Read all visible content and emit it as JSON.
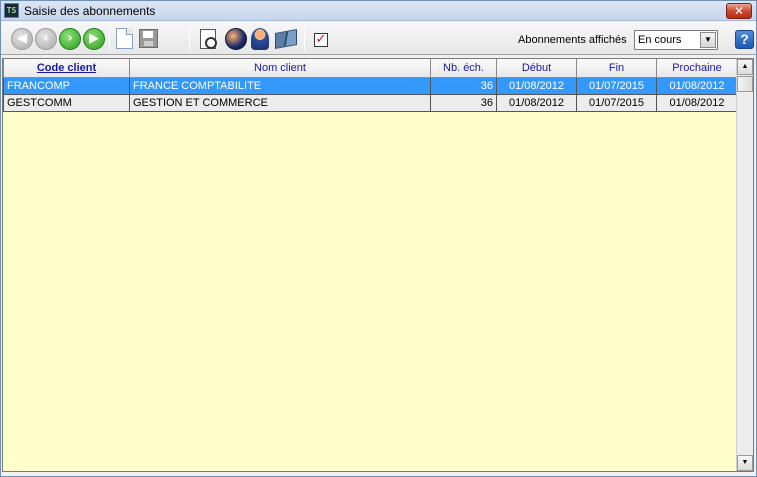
{
  "window": {
    "title": "Saisie des abonnements",
    "app_icon_text": "TS",
    "close_glyph": "✕"
  },
  "toolbar": {
    "filter_label": "Abonnements affichés",
    "filter_value": "En cours",
    "help_label": "?",
    "icons": {
      "first": "first-record-icon",
      "previous": "previous-record-icon",
      "next": "next-record-icon",
      "last": "last-record-icon",
      "new": "new-document-icon",
      "save": "save-icon",
      "preview": "print-preview-icon",
      "contacts": "people-icon",
      "person": "person-icon",
      "book": "book-icon",
      "check": "checkbox-icon"
    }
  },
  "grid": {
    "columns": [
      "Code client",
      "Nom client",
      "Nb. éch.",
      "Début",
      "Fin",
      "Prochaine"
    ],
    "sorted_column": 0,
    "rows": [
      {
        "code": "FRANCOMP",
        "name": "FRANCE COMPTABILITE",
        "nb": "36",
        "debut": "01/08/2012",
        "fin": "01/07/2015",
        "prochaine": "01/08/2012",
        "selected": true
      },
      {
        "code": "GESTCOMM",
        "name": "GESTION ET COMMERCE",
        "nb": "36",
        "debut": "01/08/2012",
        "fin": "01/07/2015",
        "prochaine": "01/08/2012",
        "selected": false
      }
    ]
  },
  "colors": {
    "selection": "#3399ff",
    "grid_background": "#ffffcc",
    "header_text": "#1a1aa8"
  }
}
